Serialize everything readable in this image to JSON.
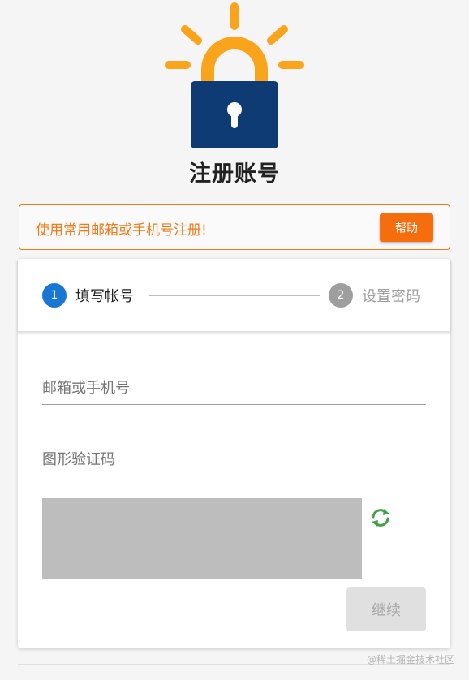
{
  "header": {
    "title": "注册账号",
    "logo_icon": "lock-icon",
    "colors": {
      "lock_body": "#0f3b74",
      "shackle_and_rays": "#f9a41a"
    }
  },
  "notice": {
    "text": "使用常用邮箱或手机号注册!",
    "help_label": "帮助",
    "colors": {
      "border_text": "#ef7a17",
      "button": "#f66d0d"
    }
  },
  "stepper": {
    "steps": [
      {
        "number": "1",
        "label": "填写帐号",
        "state": "active"
      },
      {
        "number": "2",
        "label": "设置密码",
        "state": "inactive"
      }
    ],
    "colors": {
      "active": "#1976d2",
      "inactive": "#9e9e9e"
    }
  },
  "form": {
    "email_placeholder": "邮箱或手机号",
    "captcha_placeholder": "图形验证码",
    "refresh_icon": "refresh-icon",
    "continue_label": "继续"
  },
  "watermark": "@稀土掘金技术社区"
}
